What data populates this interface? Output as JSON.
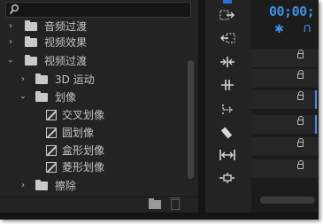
{
  "effects_panel": {
    "search_placeholder": "",
    "tree": [
      {
        "label": "音频过渡",
        "type": "folder",
        "expanded": false,
        "level": 0
      },
      {
        "label": "视频效果",
        "type": "folder",
        "expanded": false,
        "level": 0
      },
      {
        "label": "视频过渡",
        "type": "folder",
        "expanded": true,
        "level": 0
      },
      {
        "label": "3D 运动",
        "type": "folder",
        "expanded": false,
        "level": 1
      },
      {
        "label": "划像",
        "type": "folder",
        "expanded": true,
        "level": 1
      },
      {
        "label": "交叉划像",
        "type": "item",
        "level": 2
      },
      {
        "label": "圆划像",
        "type": "item",
        "level": 2
      },
      {
        "label": "盒形划像",
        "type": "item",
        "level": 2
      },
      {
        "label": "菱形划像",
        "type": "item",
        "level": 2
      },
      {
        "label": "擦除",
        "type": "folder",
        "expanded": false,
        "level": 1
      }
    ]
  },
  "tools": [
    "track-select-forward-icon",
    "track-select-backward-icon",
    "ripple-edit-icon",
    "rolling-edit-icon",
    "rate-stretch-icon",
    "razor-icon",
    "slip-icon",
    "slide-icon"
  ],
  "timeline": {
    "timecode": "00;00;",
    "colors": {
      "accent": "#3e8fe6"
    }
  }
}
